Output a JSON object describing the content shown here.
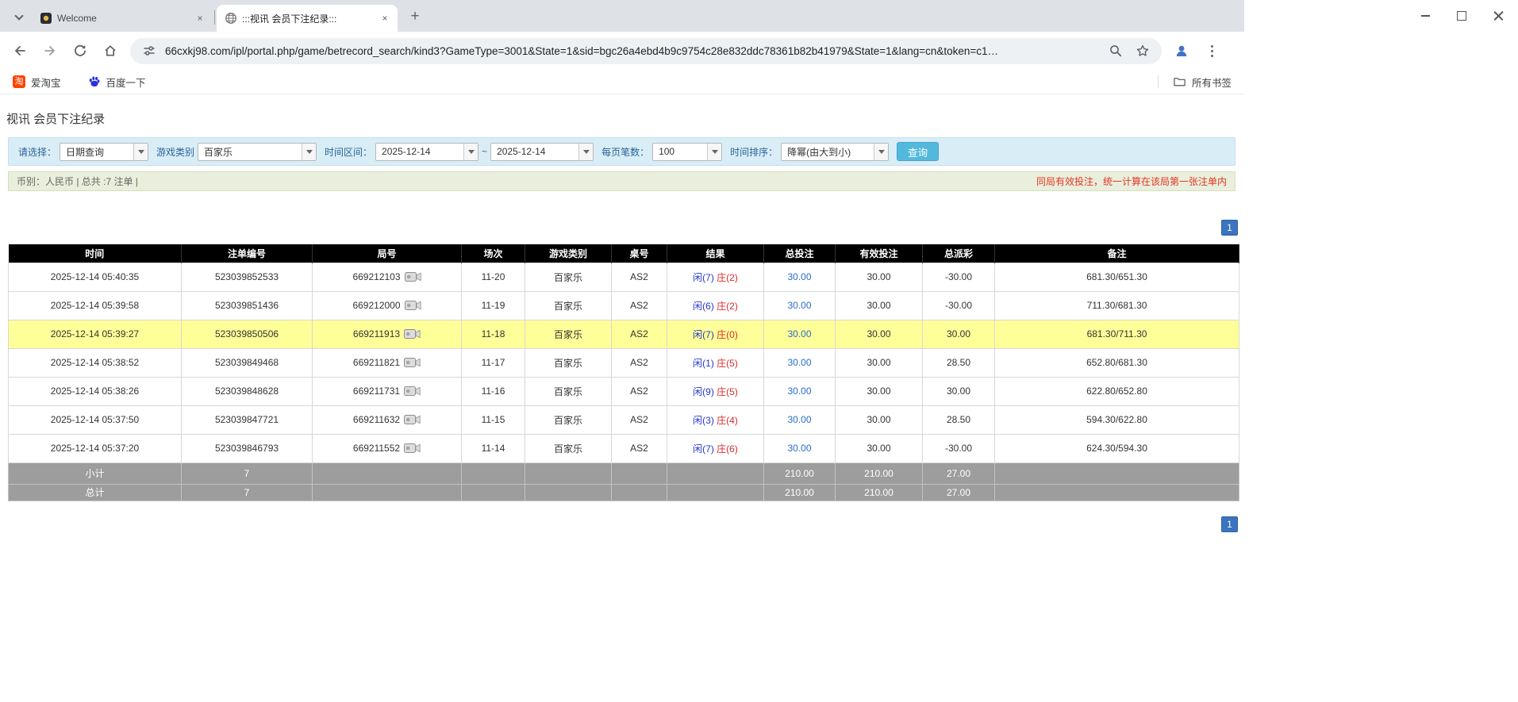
{
  "colors": {
    "header_bg": "#000000",
    "highlight_row": "#ffff99",
    "link_blue": "#2a6cc8",
    "player_blue": "#2536c9",
    "banker_red": "#d92b2b",
    "negative_red": "#e02b2b",
    "summary_gray": "#9d9d9d",
    "pager_blue": "#3b74bf",
    "search_btn_blue": "#53b9dc",
    "filter_bg": "#d9edf7",
    "notice_bg": "#e9efdc"
  },
  "icons": {
    "tab_close": "×",
    "new_tab": "+",
    "taobao_glyph": "淘"
  },
  "browser": {
    "tabs": [
      {
        "title": "Welcome"
      },
      {
        "title": ":::视讯 会员下注纪录:::"
      }
    ],
    "url": "66cxkj98.com/ipl/portal.php/game/betrecord_search/kind3?GameType=3001&State=1&sid=bgc26a4ebd4b9c9754c28e832ddc78361b82b41979&State=1&lang=cn&token=c1…",
    "bookmarks_bar": {
      "items": [
        {
          "label": "爱淘宝",
          "icon": "taobao-icon"
        },
        {
          "label": "百度一下",
          "icon": "baidu-icon"
        }
      ],
      "all_bookmarks_label": "所有书签"
    }
  },
  "page": {
    "title": "视讯 会员下注纪录",
    "filter": {
      "select_label": "请选择：",
      "select_value": "日期查询",
      "game_label": "游戏类别",
      "game_value": "百家乐",
      "range_label": "时间区间：",
      "date_from": "2025-12-14",
      "range_separator": "~",
      "date_to": "2025-12-14",
      "page_size_label": "每页笔数：",
      "page_size_value": "100",
      "sort_label": "时间排序：",
      "sort_value": "降幂(由大到小)",
      "search_button": "查询"
    },
    "summary_bar": {
      "left": "币别：人民币 | 总共 :7 注单 |",
      "right_notice": "同局有效投注，统一计算在该局第一张注单内"
    },
    "pagination": {
      "page": "1"
    },
    "table": {
      "headers": [
        "时间",
        "注单编号",
        "局号",
        "场次",
        "游戏类别",
        "桌号",
        "结果",
        "总投注",
        "有效投注",
        "总派彩",
        "备注"
      ],
      "rows": [
        {
          "time": "2025-12-14 05:40:35",
          "bet_id": "523039852533",
          "round_no": "669212103",
          "session": "11-20",
          "game": "百家乐",
          "table_no": "AS2",
          "result_player": "闲(7)",
          "result_banker": "庄(2)",
          "total_bet": "30.00",
          "valid_bet": "30.00",
          "payout": "-30.00",
          "payout_negative": true,
          "remark": "681.30/651.30",
          "highlight": false
        },
        {
          "time": "2025-12-14 05:39:58",
          "bet_id": "523039851436",
          "round_no": "669212000",
          "session": "11-19",
          "game": "百家乐",
          "table_no": "AS2",
          "result_player": "闲(6)",
          "result_banker": "庄(2)",
          "total_bet": "30.00",
          "valid_bet": "30.00",
          "payout": "-30.00",
          "payout_negative": true,
          "remark": "711.30/681.30",
          "highlight": false
        },
        {
          "time": "2025-12-14 05:39:27",
          "bet_id": "523039850506",
          "round_no": "669211913",
          "session": "11-18",
          "game": "百家乐",
          "table_no": "AS2",
          "result_player": "闲(7)",
          "result_banker": "庄(0)",
          "total_bet": "30.00",
          "valid_bet": "30.00",
          "payout": "30.00",
          "payout_negative": false,
          "remark": "681.30/711.30",
          "highlight": true
        },
        {
          "time": "2025-12-14 05:38:52",
          "bet_id": "523039849468",
          "round_no": "669211821",
          "session": "11-17",
          "game": "百家乐",
          "table_no": "AS2",
          "result_player": "闲(1)",
          "result_banker": "庄(5)",
          "total_bet": "30.00",
          "valid_bet": "30.00",
          "payout": "28.50",
          "payout_negative": false,
          "remark": "652.80/681.30",
          "highlight": false
        },
        {
          "time": "2025-12-14 05:38:26",
          "bet_id": "523039848628",
          "round_no": "669211731",
          "session": "11-16",
          "game": "百家乐",
          "table_no": "AS2",
          "result_player": "闲(9)",
          "result_banker": "庄(5)",
          "total_bet": "30.00",
          "valid_bet": "30.00",
          "payout": "30.00",
          "payout_negative": false,
          "remark": "622.80/652.80",
          "highlight": false
        },
        {
          "time": "2025-12-14 05:37:50",
          "bet_id": "523039847721",
          "round_no": "669211632",
          "session": "11-15",
          "game": "百家乐",
          "table_no": "AS2",
          "result_player": "闲(3)",
          "result_banker": "庄(4)",
          "total_bet": "30.00",
          "valid_bet": "30.00",
          "payout": "28.50",
          "payout_negative": false,
          "remark": "594.30/622.80",
          "highlight": false
        },
        {
          "time": "2025-12-14 05:37:20",
          "bet_id": "523039846793",
          "round_no": "669211552",
          "session": "11-14",
          "game": "百家乐",
          "table_no": "AS2",
          "result_player": "闲(7)",
          "result_banker": "庄(6)",
          "total_bet": "30.00",
          "valid_bet": "30.00",
          "payout": "-30.00",
          "payout_negative": true,
          "remark": "624.30/594.30",
          "highlight": false
        }
      ],
      "subtotal": {
        "label": "小计",
        "count": "7",
        "total_bet": "210.00",
        "valid_bet": "210.00",
        "payout": "27.00"
      },
      "total": {
        "label": "总计",
        "count": "7",
        "total_bet": "210.00",
        "valid_bet": "210.00",
        "payout": "27.00"
      }
    }
  }
}
